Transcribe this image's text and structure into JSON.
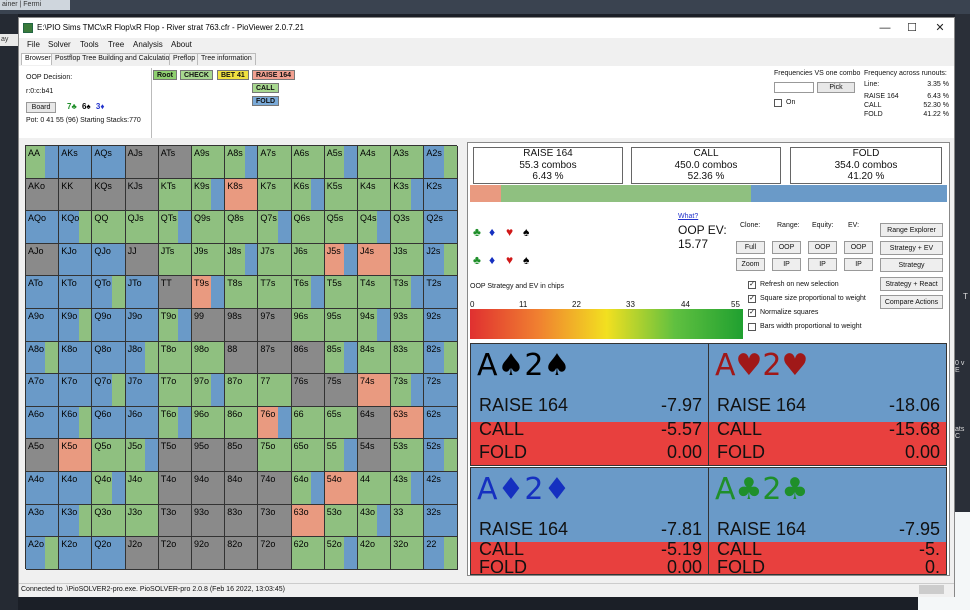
{
  "background": {
    "browser_tab": "ainer | Fermi",
    "left_strip_text": "ay",
    "right_fragments": [
      "T",
      "0 v E",
      "ats C"
    ]
  },
  "window": {
    "title": "E:\\PIO Sims TMC\\xR Flop\\xR Flop - River strat 763.cfr - PioViewer 2.0.7.21",
    "controls": {
      "minimize": "—",
      "maximize": "☐",
      "close": "✕"
    }
  },
  "menu": [
    "File",
    "Solver",
    "Tools",
    "Tree",
    "Analysis",
    "About"
  ],
  "tabs": [
    {
      "label": "Browser",
      "active": true
    },
    {
      "label": "Postflop Tree Building and Calculations",
      "active": false
    },
    {
      "label": "Preflop",
      "active": false
    },
    {
      "label": "Tree information",
      "active": false
    }
  ],
  "decision": {
    "label": "OOP Decision:",
    "line": "r:0:c:b41",
    "board_button": "Board",
    "board_cards": [
      "7♣",
      "6♠",
      "3♦"
    ],
    "pot_line": "Pot: 0 41 55 (96) Starting Stacks:770"
  },
  "tree": {
    "root": "Root",
    "check": "CHECK",
    "bet": "BET 41",
    "raise": "RAISE 164",
    "call": "CALL",
    "fold": "FOLD"
  },
  "frequencies": {
    "label": "Frequencies VS one combo",
    "pick_button": "Pick",
    "on_label": "On"
  },
  "runouts": {
    "title": "Frequency across runouts:",
    "rows": [
      {
        "name": "Line:",
        "value": "3.35 %"
      },
      {
        "name": "RAISE 164",
        "value": "6.43 %"
      },
      {
        "name": "CALL",
        "value": "52.30 %"
      },
      {
        "name": "FOLD",
        "value": "41.22 %"
      }
    ]
  },
  "actions": [
    {
      "name": "RAISE 164",
      "combos": "55.3 combos",
      "pct": "6.43 %",
      "color": "#e99a80"
    },
    {
      "name": "CALL",
      "combos": "450.0 combos",
      "pct": "52.36 %",
      "color": "#8fc080"
    },
    {
      "name": "FOLD",
      "combos": "354.0 combos",
      "pct": "41.20 %",
      "color": "#6a9ac8"
    }
  ],
  "freq_bar": {
    "raise": 0.0643,
    "call": 0.5236,
    "fold": 0.412
  },
  "suit_filters": {
    "row1": [
      "♣",
      "♦",
      "♥",
      "♠"
    ],
    "row2": [
      "♣",
      "♦",
      "♥",
      "♠"
    ]
  },
  "ev": {
    "what": "What?",
    "label": "OOP EV:",
    "value": "15.77"
  },
  "options": {
    "headers": [
      "Clone:",
      "Range:",
      "Equity:",
      "EV:"
    ],
    "row1": [
      "Full",
      "OOP",
      "OOP",
      "OOP"
    ],
    "row2": [
      "Zoom",
      "IP",
      "IP",
      "IP"
    ],
    "side_buttons": [
      "Range Explorer",
      "Strategy + EV",
      "Strategy",
      "Strategy + React",
      "Compare Actions"
    ],
    "checks": [
      {
        "label": "Refresh on new selection",
        "checked": true
      },
      {
        "label": "Square size proportional to weight",
        "checked": true
      },
      {
        "label": "Normalize squares",
        "checked": true
      },
      {
        "label": "Bars width proportional to weight",
        "checked": false
      }
    ]
  },
  "scale": {
    "title": "OOP Strategy and EV in chips",
    "ticks": [
      "0",
      "11",
      "22",
      "33",
      "44",
      "55"
    ]
  },
  "combos": [
    {
      "cards": "A♠2♠",
      "color": "#000000",
      "raise": "-7.97",
      "call": "-5.57",
      "fold": "0.00"
    },
    {
      "cards": "A♥2♥",
      "color": "#a01818",
      "raise": "-18.06",
      "call": "-15.68",
      "fold": "0.00"
    },
    {
      "cards": "A♦2♦",
      "color": "#1530c0",
      "raise": "-7.81",
      "call": "-5.19",
      "fold": "0.00"
    },
    {
      "cards": "A♣2♣",
      "color": "#1f8f2a",
      "raise": "-7.95",
      "call": "-5.",
      "fold": "0."
    }
  ],
  "combo_labels": {
    "raise": "RAISE 164",
    "call": "CALL",
    "fold": "FOLD"
  },
  "status": "Connected to .\\PioSOLVER2-pro.exe. PioSOLVER-pro 2.0.8 (Feb 16 2022, 13:03:45)",
  "grid_rows": [
    "AA AKs AQs AJs ATs A9s A8s A7s A6s A5s A4s A3s A2s",
    "AKo KK KQs KJs KTs K9s K8s K7s K6s K5s K4s K3s K2s",
    "AQo KQo QQ QJs QTs Q9s Q8s Q7s Q6s Q5s Q4s Q3s Q2s",
    "AJo KJo QJo JJ JTs J9s J8s J7s J6s J5s J4s J3s J2s",
    "ATo KTo QTo JTo TT T9s T8s T7s T6s T5s T4s T3s T2s",
    "A9o K9o Q9o J9o T9o 99 98s 97s 96s 95s 94s 93s 92s",
    "A8o K8o Q8o J8o T8o 98o 88 87s 86s 85s 84s 83s 82s",
    "A7o K7o Q7o J7o T7o 97o 87o 77 76s 75s 74s 73s 72s",
    "A6o K6o Q6o J6o T6o 96o 86o 76o 66 65s 64s 63s 62s",
    "A5o K5o Q5o J5o T5o 95o 85o 75o 65o 55 54s 53s 52s",
    "A4o K4o Q4o J4o T4o 94o 84o 74o 64o 54o 44 43s 42s",
    "A3o K3o Q3o J3o T3o 93o 83o 73o 63o 53o 43o 33 32s",
    "A2o K2o Q2o J2o T2o 92o 82o 72o 62o 52o 42o 32o 22"
  ],
  "grid_colors": [
    "G B B X X G G G G G G G B",
    "X X X X G G R G G G G G B",
    "B B G G G G G G G G G G B",
    "X B B X G G G G G R R G B",
    "B B B B X R G G G G G G B",
    "B B B B G X X X G G G G B",
    "B B B B G G X X X G G G B",
    "B B B B G G G G X X R G B",
    "B B B B G G G R G G X R B",
    "X R G G X X X G G G X G B",
    "B B G G X X X X G R G G B",
    "B B G G X X X X R G G G B",
    "B B B X X X X X G G G G B"
  ]
}
